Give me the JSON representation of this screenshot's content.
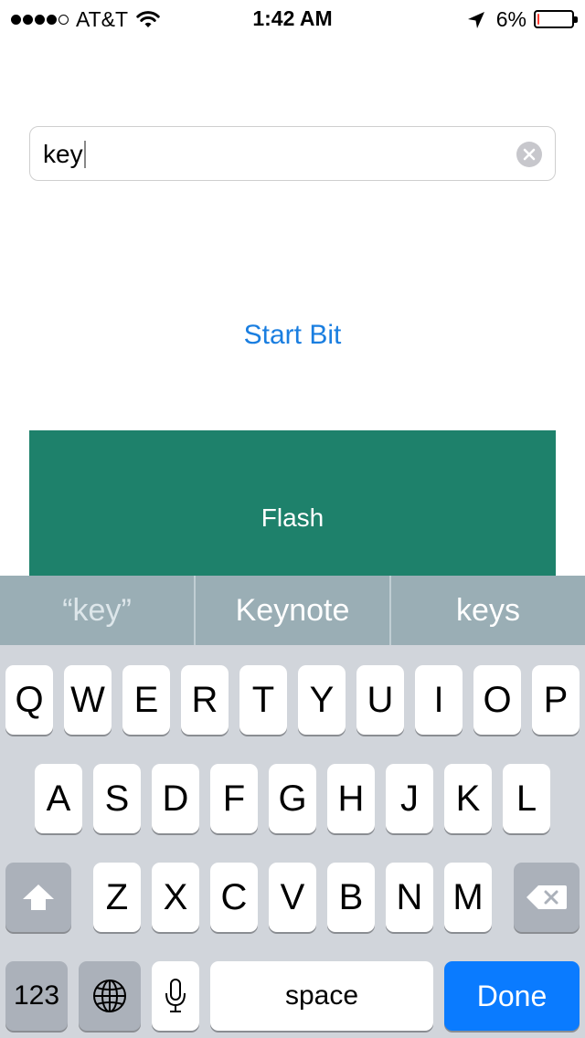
{
  "status_bar": {
    "carrier": "AT&T",
    "time": "1:42 AM",
    "battery_percent": "6%",
    "battery_level": 0.06,
    "signal_bars_filled": 4,
    "signal_bars_total": 5
  },
  "text_field": {
    "value": "key",
    "clear_icon": "clear-x-circle-icon"
  },
  "start_bit_button": {
    "label": "Start Bit"
  },
  "flash_button": {
    "label": "Flash",
    "color": "#1e816b"
  },
  "keyboard": {
    "suggestions": [
      "“key”",
      "Keynote",
      "keys"
    ],
    "row1": [
      "Q",
      "W",
      "E",
      "R",
      "T",
      "Y",
      "U",
      "I",
      "O",
      "P"
    ],
    "row2": [
      "A",
      "S",
      "D",
      "F",
      "G",
      "H",
      "J",
      "K",
      "L"
    ],
    "row3": [
      "Z",
      "X",
      "C",
      "V",
      "B",
      "N",
      "M"
    ],
    "shift_icon": "shift-arrow-icon",
    "delete_icon": "backspace-icon",
    "numbers_label": "123",
    "globe_icon": "globe-icon",
    "mic_icon": "microphone-icon",
    "space_label": "space",
    "done_label": "Done",
    "done_color": "#0a7bff"
  }
}
